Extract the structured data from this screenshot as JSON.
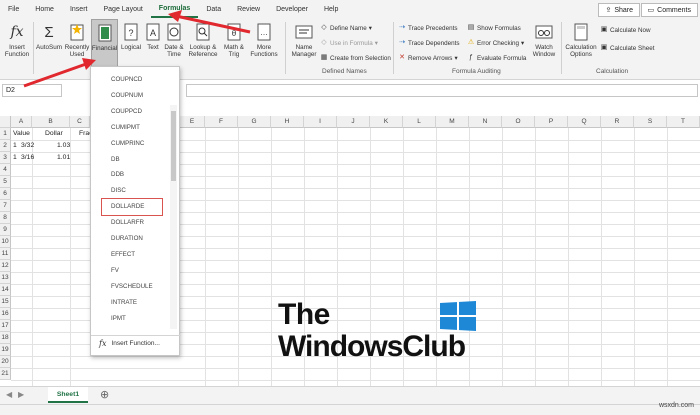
{
  "menu": {
    "tabs": [
      "File",
      "Home",
      "Insert",
      "Page Layout",
      "Formulas",
      "Data",
      "Review",
      "Developer",
      "Help"
    ],
    "active_tab": "Formulas",
    "share_label": "Share",
    "comments_label": "Comments"
  },
  "ribbon": {
    "insert_function": "Insert\nFunction",
    "autosum": "AutoSum",
    "recently_used": "Recently\nUsed",
    "financial": "Financial",
    "logical": "Logical",
    "text": "Text",
    "date_time": "Date &\nTime",
    "lookup_reference": "Lookup &\nReference",
    "math_trig": "Math &\nTrig",
    "more_functions": "More\nFunctions",
    "name_manager": "Name\nManager",
    "define_name": "Define Name",
    "use_in_formula": "Use in Formula",
    "create_from_selection": "Create from Selection",
    "defined_names_label": "Defined Names",
    "trace_precedents": "Trace Precedents",
    "trace_dependents": "Trace Dependents",
    "remove_arrows": "Remove Arrows",
    "show_formulas": "Show Formulas",
    "error_checking": "Error Checking",
    "evaluate_formula": "Evaluate Formula",
    "formula_auditing_label": "Formula Auditing",
    "watch_window": "Watch\nWindow",
    "calculation_options": "Calculation\nOptions",
    "calculate_now": "Calculate Now",
    "calculate_sheet": "Calculate Sheet",
    "calculation_label": "Calculation"
  },
  "formula_bar": {
    "name_box": "D2"
  },
  "grid": {
    "columns": [
      "A",
      "B",
      "C",
      "D",
      "E",
      "F",
      "G",
      "H",
      "I",
      "J",
      "K",
      "L",
      "M",
      "N",
      "O",
      "P",
      "Q",
      "R",
      "S",
      "T"
    ],
    "rows": [
      "1",
      "2",
      "3",
      "4",
      "5",
      "6",
      "7",
      "8",
      "9",
      "10",
      "11",
      "12",
      "13",
      "14",
      "15",
      "16",
      "17",
      "18",
      "19",
      "20",
      "21"
    ],
    "cells": {
      "A1": "Value",
      "B1": "Dollar",
      "C1": "Frac",
      "A2a": "1",
      "A2b": "3/32",
      "B2": "1.03",
      "A3a": "1",
      "A3b": "3/16",
      "B3": "1.01"
    }
  },
  "dropdown": {
    "items": [
      "COUPNCD",
      "COUPNUM",
      "COUPPCD",
      "CUMIPMT",
      "CUMPRINC",
      "DB",
      "DDB",
      "DISC",
      "DOLLARDE",
      "DOLLARFR",
      "DURATION",
      "EFFECT",
      "FV",
      "FVSCHEDULE",
      "INTRATE",
      "IPMT"
    ],
    "highlighted": "DOLLARDE",
    "insert_function": "Insert Function..."
  },
  "sheet": {
    "tab": "Sheet1"
  },
  "watermark": {
    "line1": "The",
    "line2": "WindowsClub"
  },
  "site": "wsxdn.com",
  "colors": {
    "accent": "#217346",
    "arrow": "#e0282e",
    "highlight_box": "#d9534f"
  }
}
